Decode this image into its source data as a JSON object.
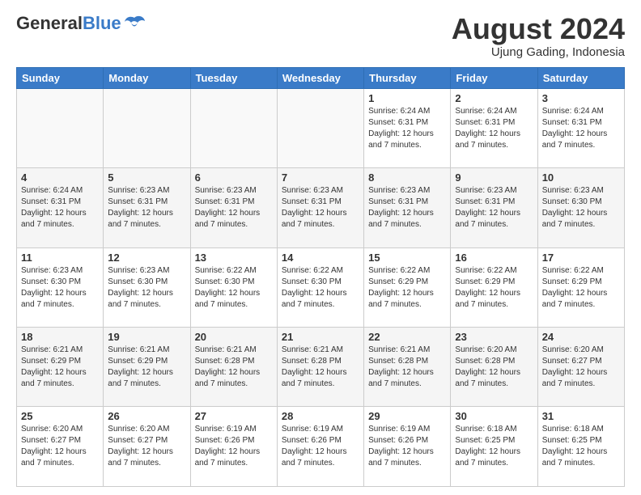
{
  "header": {
    "logo_general": "General",
    "logo_blue": "Blue",
    "month_year": "August 2024",
    "location": "Ujung Gading, Indonesia"
  },
  "days_of_week": [
    "Sunday",
    "Monday",
    "Tuesday",
    "Wednesday",
    "Thursday",
    "Friday",
    "Saturday"
  ],
  "weeks": [
    [
      {
        "day": "",
        "info": ""
      },
      {
        "day": "",
        "info": ""
      },
      {
        "day": "",
        "info": ""
      },
      {
        "day": "",
        "info": ""
      },
      {
        "day": "1",
        "info": "Sunrise: 6:24 AM\nSunset: 6:31 PM\nDaylight: 12 hours\nand 7 minutes."
      },
      {
        "day": "2",
        "info": "Sunrise: 6:24 AM\nSunset: 6:31 PM\nDaylight: 12 hours\nand 7 minutes."
      },
      {
        "day": "3",
        "info": "Sunrise: 6:24 AM\nSunset: 6:31 PM\nDaylight: 12 hours\nand 7 minutes."
      }
    ],
    [
      {
        "day": "4",
        "info": "Sunrise: 6:24 AM\nSunset: 6:31 PM\nDaylight: 12 hours\nand 7 minutes."
      },
      {
        "day": "5",
        "info": "Sunrise: 6:23 AM\nSunset: 6:31 PM\nDaylight: 12 hours\nand 7 minutes."
      },
      {
        "day": "6",
        "info": "Sunrise: 6:23 AM\nSunset: 6:31 PM\nDaylight: 12 hours\nand 7 minutes."
      },
      {
        "day": "7",
        "info": "Sunrise: 6:23 AM\nSunset: 6:31 PM\nDaylight: 12 hours\nand 7 minutes."
      },
      {
        "day": "8",
        "info": "Sunrise: 6:23 AM\nSunset: 6:31 PM\nDaylight: 12 hours\nand 7 minutes."
      },
      {
        "day": "9",
        "info": "Sunrise: 6:23 AM\nSunset: 6:31 PM\nDaylight: 12 hours\nand 7 minutes."
      },
      {
        "day": "10",
        "info": "Sunrise: 6:23 AM\nSunset: 6:30 PM\nDaylight: 12 hours\nand 7 minutes."
      }
    ],
    [
      {
        "day": "11",
        "info": "Sunrise: 6:23 AM\nSunset: 6:30 PM\nDaylight: 12 hours\nand 7 minutes."
      },
      {
        "day": "12",
        "info": "Sunrise: 6:23 AM\nSunset: 6:30 PM\nDaylight: 12 hours\nand 7 minutes."
      },
      {
        "day": "13",
        "info": "Sunrise: 6:22 AM\nSunset: 6:30 PM\nDaylight: 12 hours\nand 7 minutes."
      },
      {
        "day": "14",
        "info": "Sunrise: 6:22 AM\nSunset: 6:30 PM\nDaylight: 12 hours\nand 7 minutes."
      },
      {
        "day": "15",
        "info": "Sunrise: 6:22 AM\nSunset: 6:29 PM\nDaylight: 12 hours\nand 7 minutes."
      },
      {
        "day": "16",
        "info": "Sunrise: 6:22 AM\nSunset: 6:29 PM\nDaylight: 12 hours\nand 7 minutes."
      },
      {
        "day": "17",
        "info": "Sunrise: 6:22 AM\nSunset: 6:29 PM\nDaylight: 12 hours\nand 7 minutes."
      }
    ],
    [
      {
        "day": "18",
        "info": "Sunrise: 6:21 AM\nSunset: 6:29 PM\nDaylight: 12 hours\nand 7 minutes."
      },
      {
        "day": "19",
        "info": "Sunrise: 6:21 AM\nSunset: 6:29 PM\nDaylight: 12 hours\nand 7 minutes."
      },
      {
        "day": "20",
        "info": "Sunrise: 6:21 AM\nSunset: 6:28 PM\nDaylight: 12 hours\nand 7 minutes."
      },
      {
        "day": "21",
        "info": "Sunrise: 6:21 AM\nSunset: 6:28 PM\nDaylight: 12 hours\nand 7 minutes."
      },
      {
        "day": "22",
        "info": "Sunrise: 6:21 AM\nSunset: 6:28 PM\nDaylight: 12 hours\nand 7 minutes."
      },
      {
        "day": "23",
        "info": "Sunrise: 6:20 AM\nSunset: 6:28 PM\nDaylight: 12 hours\nand 7 minutes."
      },
      {
        "day": "24",
        "info": "Sunrise: 6:20 AM\nSunset: 6:27 PM\nDaylight: 12 hours\nand 7 minutes."
      }
    ],
    [
      {
        "day": "25",
        "info": "Sunrise: 6:20 AM\nSunset: 6:27 PM\nDaylight: 12 hours\nand 7 minutes."
      },
      {
        "day": "26",
        "info": "Sunrise: 6:20 AM\nSunset: 6:27 PM\nDaylight: 12 hours\nand 7 minutes."
      },
      {
        "day": "27",
        "info": "Sunrise: 6:19 AM\nSunset: 6:26 PM\nDaylight: 12 hours\nand 7 minutes."
      },
      {
        "day": "28",
        "info": "Sunrise: 6:19 AM\nSunset: 6:26 PM\nDaylight: 12 hours\nand 7 minutes."
      },
      {
        "day": "29",
        "info": "Sunrise: 6:19 AM\nSunset: 6:26 PM\nDaylight: 12 hours\nand 7 minutes."
      },
      {
        "day": "30",
        "info": "Sunrise: 6:18 AM\nSunset: 6:25 PM\nDaylight: 12 hours\nand 7 minutes."
      },
      {
        "day": "31",
        "info": "Sunrise: 6:18 AM\nSunset: 6:25 PM\nDaylight: 12 hours\nand 7 minutes."
      }
    ]
  ]
}
